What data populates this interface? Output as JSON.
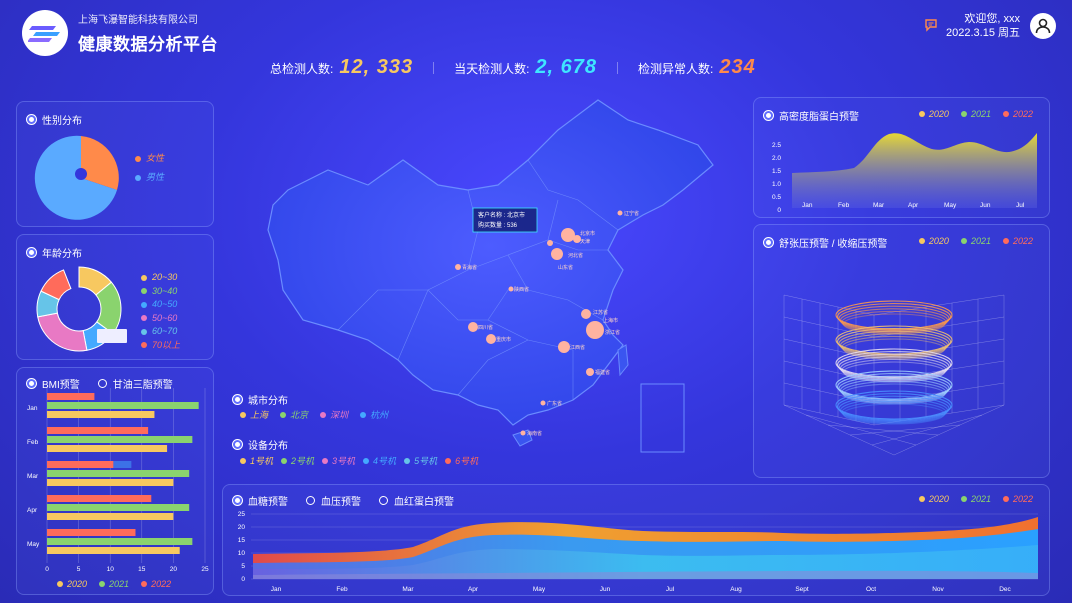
{
  "header": {
    "company": "上海飞瀑智能科技有限公司",
    "platform": "健康数据分析平台",
    "welcome": "欢迎您, xxx",
    "date": "2022.3.15 周五"
  },
  "stats": [
    {
      "label": "总检测人数:",
      "value": "12, 333",
      "color": "#f7c860"
    },
    {
      "label": "当天检测人数:",
      "value": "2, 678",
      "color": "#3ee6ff"
    },
    {
      "label": "检测异常人数:",
      "value": "234",
      "color": "#ff8a4a"
    }
  ],
  "gender": {
    "title": "性别分布",
    "legend": [
      {
        "label": "女性",
        "color": "#ff8a4a"
      },
      {
        "label": "男性",
        "color": "#5aaaff"
      }
    ],
    "slices": [
      0.33,
      0.67
    ]
  },
  "age": {
    "title": "年龄分布",
    "legend": [
      {
        "label": "20~30",
        "color": "#f7c860"
      },
      {
        "label": "30~40",
        "color": "#8ad36e"
      },
      {
        "label": "40~50",
        "color": "#44a9ff"
      },
      {
        "label": "50~60",
        "color": "#e879c4"
      },
      {
        "label": "60~70",
        "color": "#66c4e8"
      },
      {
        "label": "70以上",
        "color": "#ff6b5b"
      }
    ],
    "slices": [
      0.14,
      0.21,
      0.12,
      0.25,
      0.1,
      0.12
    ]
  },
  "bmi": {
    "tabs": [
      "BMI预警",
      "甘油三脂预警"
    ],
    "months": [
      "Jan",
      "Feb",
      "Mar",
      "Apr",
      "May"
    ],
    "xticks": [
      "0",
      "5",
      "10",
      "15",
      "20",
      "25"
    ],
    "series": [
      {
        "name": "2020",
        "color": "#f7c860",
        "values": [
          17,
          19,
          20,
          20,
          21
        ]
      },
      {
        "name": "2021",
        "color": "#8ad36e",
        "values": [
          24,
          23,
          22.5,
          22.5,
          23
        ]
      },
      {
        "name": "2022",
        "color": "#ff6b5b",
        "values": [
          7.5,
          16,
          10.5,
          16.5,
          14
        ]
      }
    ],
    "legend": [
      "2020",
      "2021",
      "2022"
    ]
  },
  "map": {
    "tooltip": [
      "客户名称 : 北京市",
      "购买数量 : 536"
    ],
    "cities": {
      "title": "城市分布",
      "items": [
        "上海",
        "北京",
        "深圳",
        "杭州"
      ],
      "colors": [
        "#f7c860",
        "#8ad36e",
        "#e879c4",
        "#44a9ff"
      ]
    },
    "devices": {
      "title": "设备分布",
      "items": [
        "1号机",
        "2号机",
        "3号机",
        "4号机",
        "5号机",
        "6号机"
      ],
      "colors": [
        "#f7c860",
        "#8ad36e",
        "#e879c4",
        "#44a9ff",
        "#66c4e8",
        "#ff6b5b"
      ]
    },
    "labels": [
      "辽宁省",
      "北京市",
      "天津",
      "河北省",
      "山东省",
      "青海省",
      "陕西省",
      "四川省",
      "重庆市",
      "江苏省",
      "上海市",
      "浙江省",
      "江西省",
      "福建省",
      "广东省",
      "海南省"
    ]
  },
  "hdl": {
    "title": "高密度脂蛋白预警",
    "legend": [
      "2020",
      "2021",
      "2022"
    ],
    "yticks": [
      "2.5",
      "2.0",
      "1.5",
      "1.0",
      "0.5",
      "0"
    ],
    "xticks": [
      "Jan",
      "Feb",
      "Mar",
      "Apr",
      "May",
      "Jun",
      "Jul"
    ]
  },
  "bp": {
    "title": "舒张压预警 / 收缩压预警",
    "legend": [
      "2020",
      "2021",
      "2022"
    ]
  },
  "sugar": {
    "tabs": [
      "血糖预警",
      "血压预警",
      "血红蛋白预警"
    ],
    "legend": [
      "2020",
      "2021",
      "2022"
    ],
    "yticks": [
      "25",
      "20",
      "15",
      "10",
      "5",
      "0"
    ],
    "xticks": [
      "Jan",
      "Feb",
      "Mar",
      "Apr",
      "May",
      "Jun",
      "Jul",
      "Aug",
      "Sept",
      "Oct",
      "Nov",
      "Dec"
    ]
  },
  "legendColors": {
    "2020": "#f7c860",
    "2021": "#8ad36e",
    "2022": "#ff6b5b"
  }
}
